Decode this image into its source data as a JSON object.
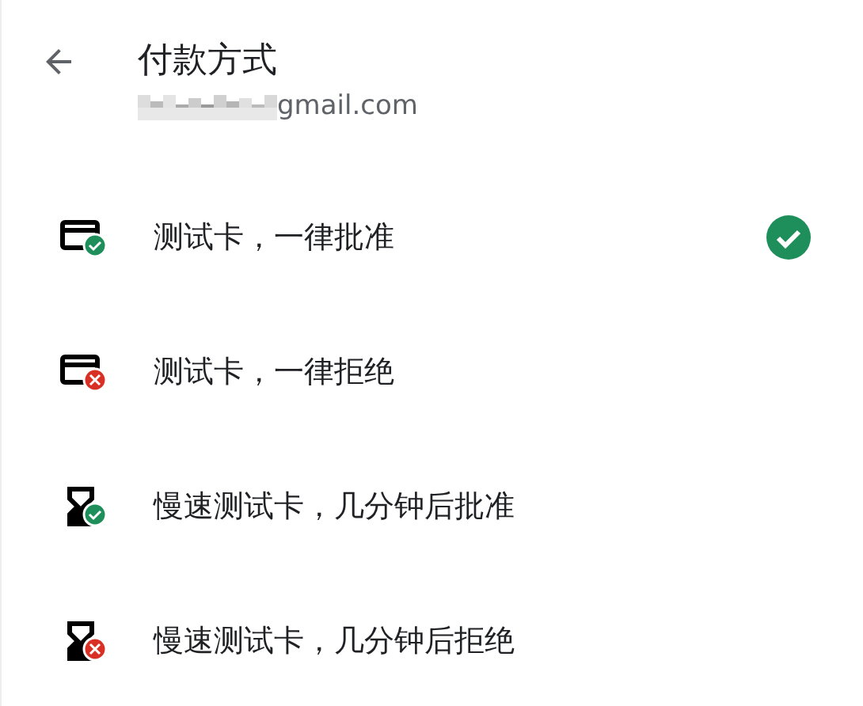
{
  "header": {
    "title": "付款方式",
    "account": "gmail.com"
  },
  "options": [
    {
      "label": "测试卡，一律批准",
      "kind": "card",
      "approved": true,
      "selected": true
    },
    {
      "label": "测试卡，一律拒绝",
      "kind": "card",
      "approved": false,
      "selected": false
    },
    {
      "label": "慢速测试卡，几分钟后批准",
      "kind": "slow",
      "approved": true,
      "selected": false
    },
    {
      "label": "慢速测试卡，几分钟后拒绝",
      "kind": "slow",
      "approved": false,
      "selected": false
    }
  ]
}
